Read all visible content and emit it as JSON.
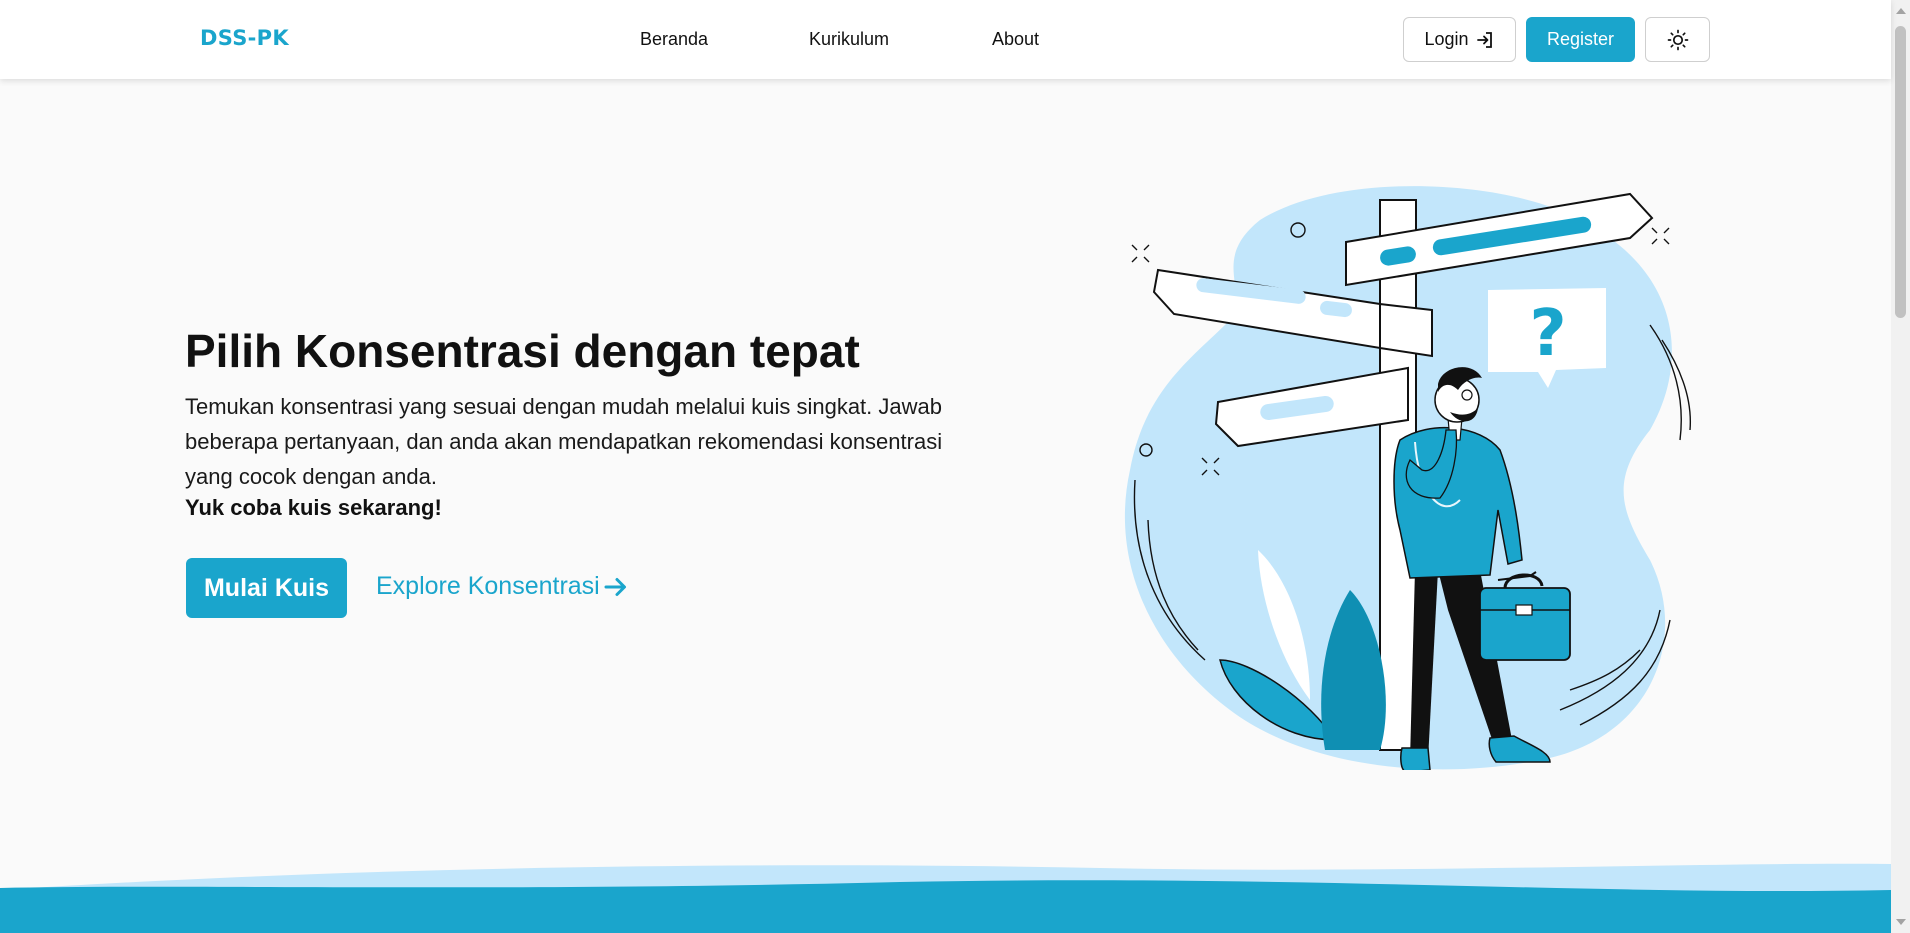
{
  "navbar": {
    "brand": "DSS-PK",
    "links": [
      "Beranda",
      "Kurikulum",
      "About"
    ],
    "login_label": "Login",
    "register_label": "Register",
    "theme_icon": "sun-icon",
    "login_icon": "login-arrow-icon"
  },
  "hero": {
    "title": "Pilih Konsentrasi dengan tepat",
    "description": "Temukan konsentrasi yang sesuai dengan mudah melalui kuis singkat. Jawab beberapa pertanyaan, dan anda akan mendapatkan rekomendasi konsentrasi yang cocok dengan anda.",
    "cta_text": "Yuk coba kuis sekarang!",
    "start_button": "Mulai Kuis",
    "explore_link": "Explore Konsentrasi",
    "explore_icon": "arrow-right-icon"
  },
  "colors": {
    "accent": "#1aa5cc",
    "light_blue": "#c2e6fb",
    "dark_teal": "#0f8fb3"
  }
}
